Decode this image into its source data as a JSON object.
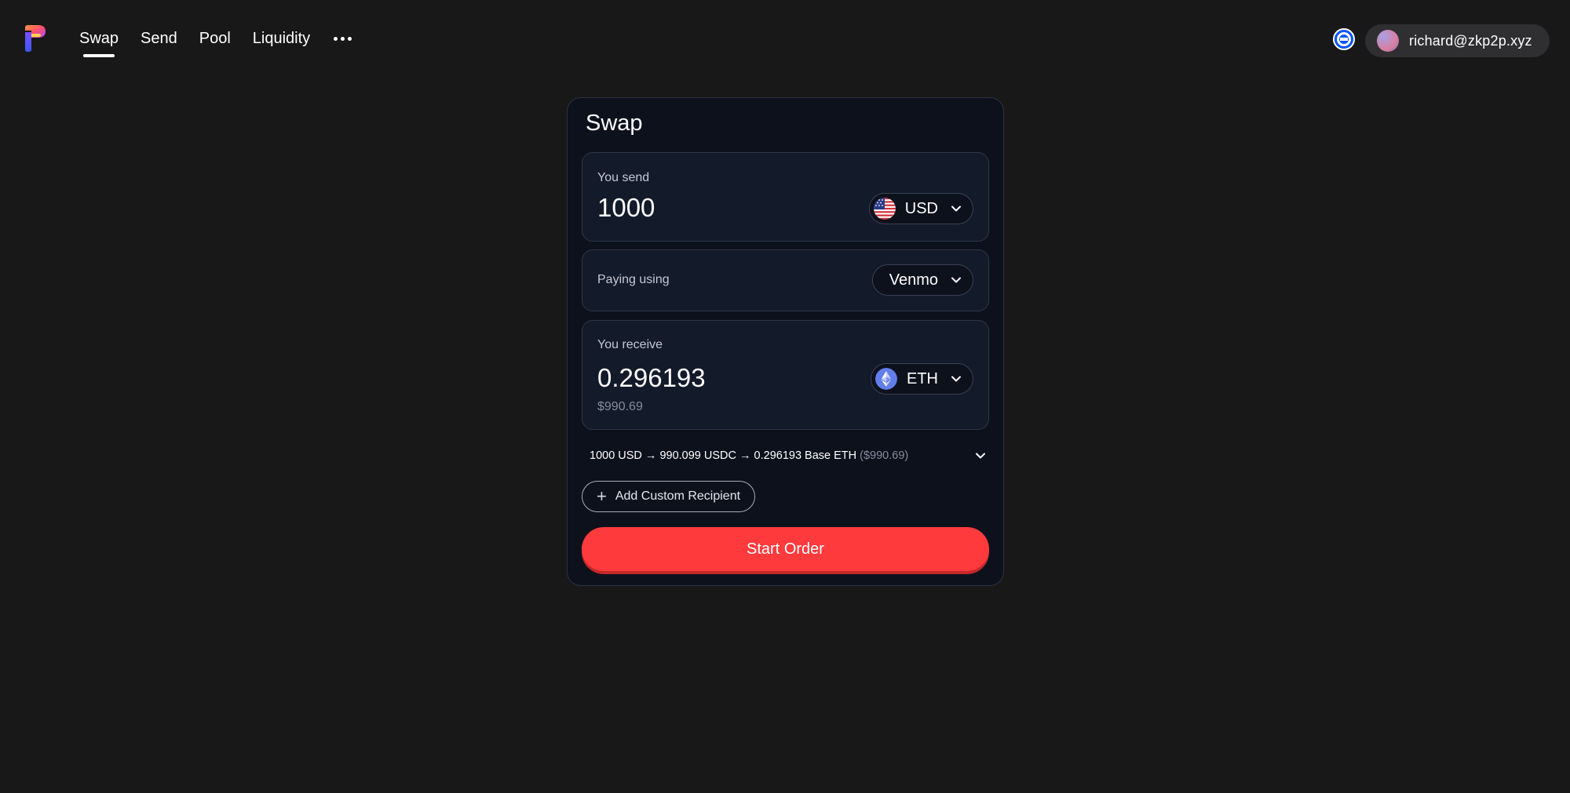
{
  "nav": {
    "items": [
      {
        "label": "Swap",
        "active": true
      },
      {
        "label": "Send",
        "active": false
      },
      {
        "label": "Pool",
        "active": false
      },
      {
        "label": "Liquidity",
        "active": false
      }
    ],
    "more_icon": "more-horizontal-icon"
  },
  "header": {
    "network_icon": "base-network-icon",
    "account_email": "richard@zkp2p.xyz"
  },
  "swap": {
    "title": "Swap",
    "send": {
      "label": "You send",
      "amount": "1000",
      "currency": "USD",
      "currency_icon": "us-flag-icon"
    },
    "payment": {
      "label": "Paying using",
      "method": "Venmo"
    },
    "receive": {
      "label": "You receive",
      "amount": "0.296193",
      "usd_value": "$990.69",
      "token": "ETH",
      "token_icon": "eth-icon"
    },
    "route": {
      "text": "1000 USD → 990.099 USDC → 0.296193 Base ETH",
      "usd": "($990.69)"
    },
    "add_recipient_label": "Add Custom Recipient",
    "start_label": "Start Order"
  },
  "colors": {
    "background": "#181818",
    "card": "#0d111c",
    "panel": "#131a2a",
    "accent": "#ff3a3d",
    "network_blue": "#0052ff"
  }
}
